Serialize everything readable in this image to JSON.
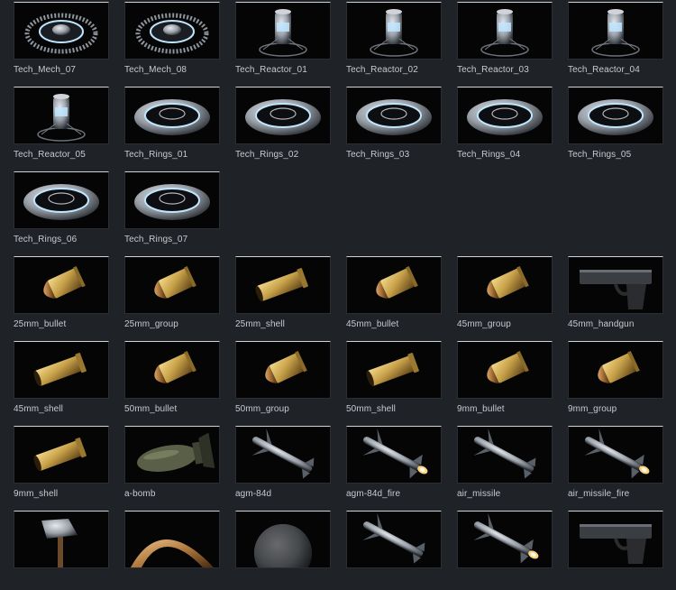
{
  "assets": [
    {
      "label": "Tech_Mech_07",
      "icon": "tech-mech-icon"
    },
    {
      "label": "Tech_Mech_08",
      "icon": "tech-mech-icon"
    },
    {
      "label": "Tech_Reactor_01",
      "icon": "tech-reactor-icon"
    },
    {
      "label": "Tech_Reactor_02",
      "icon": "tech-reactor-icon"
    },
    {
      "label": "Tech_Reactor_03",
      "icon": "tech-reactor-icon"
    },
    {
      "label": "Tech_Reactor_04",
      "icon": "tech-reactor-icon"
    },
    {
      "label": "Tech_Reactor_05",
      "icon": "tech-reactor-icon"
    },
    {
      "label": "Tech_Rings_01",
      "icon": "tech-rings-icon"
    },
    {
      "label": "Tech_Rings_02",
      "icon": "tech-rings-icon"
    },
    {
      "label": "Tech_Rings_03",
      "icon": "tech-rings-icon"
    },
    {
      "label": "Tech_Rings_04",
      "icon": "tech-rings-icon"
    },
    {
      "label": "Tech_Rings_05",
      "icon": "tech-rings-icon"
    },
    {
      "label": "Tech_Rings_06",
      "icon": "tech-rings-icon"
    },
    {
      "label": "Tech_Rings_07",
      "icon": "tech-rings-icon"
    },
    {
      "label": "25mm_bullet",
      "icon": "bullet-icon"
    },
    {
      "label": "25mm_group",
      "icon": "bullet-icon"
    },
    {
      "label": "25mm_shell",
      "icon": "shell-icon"
    },
    {
      "label": "45mm_bullet",
      "icon": "bullet-icon"
    },
    {
      "label": "45mm_group",
      "icon": "bullet-icon"
    },
    {
      "label": "45mm_handgun",
      "icon": "handgun-icon"
    },
    {
      "label": "45mm_shell",
      "icon": "shell-icon"
    },
    {
      "label": "50mm_bullet",
      "icon": "bullet-icon"
    },
    {
      "label": "50mm_group",
      "icon": "bullet-icon"
    },
    {
      "label": "50mm_shell",
      "icon": "shell-icon"
    },
    {
      "label": "9mm_bullet",
      "icon": "bullet-icon"
    },
    {
      "label": "9mm_group",
      "icon": "bullet-icon"
    },
    {
      "label": "9mm_shell",
      "icon": "shell-icon"
    },
    {
      "label": "a-bomb",
      "icon": "bomb-icon"
    },
    {
      "label": "agm-84d",
      "icon": "missile-icon"
    },
    {
      "label": "agm-84d_fire",
      "icon": "missile-fire-icon"
    },
    {
      "label": "air_missile",
      "icon": "missile-icon"
    },
    {
      "label": "air_missile_fire",
      "icon": "missile-fire-icon"
    },
    {
      "label": "",
      "icon": "axe-icon"
    },
    {
      "label": "",
      "icon": "boomerang-icon"
    },
    {
      "label": "",
      "icon": "ball-icon"
    },
    {
      "label": "",
      "icon": "missile-icon"
    },
    {
      "label": "",
      "icon": "missile-fire-icon"
    },
    {
      "label": "",
      "icon": "handgun-icon"
    }
  ],
  "colors": {
    "background": "#1f2227",
    "thumb_background": "#050505",
    "label_text": "#c7cbd1",
    "metal": "#9aa0a8",
    "glow": "#bfe6ff",
    "brass": "#c8a24a",
    "copper": "#b07a3e"
  }
}
